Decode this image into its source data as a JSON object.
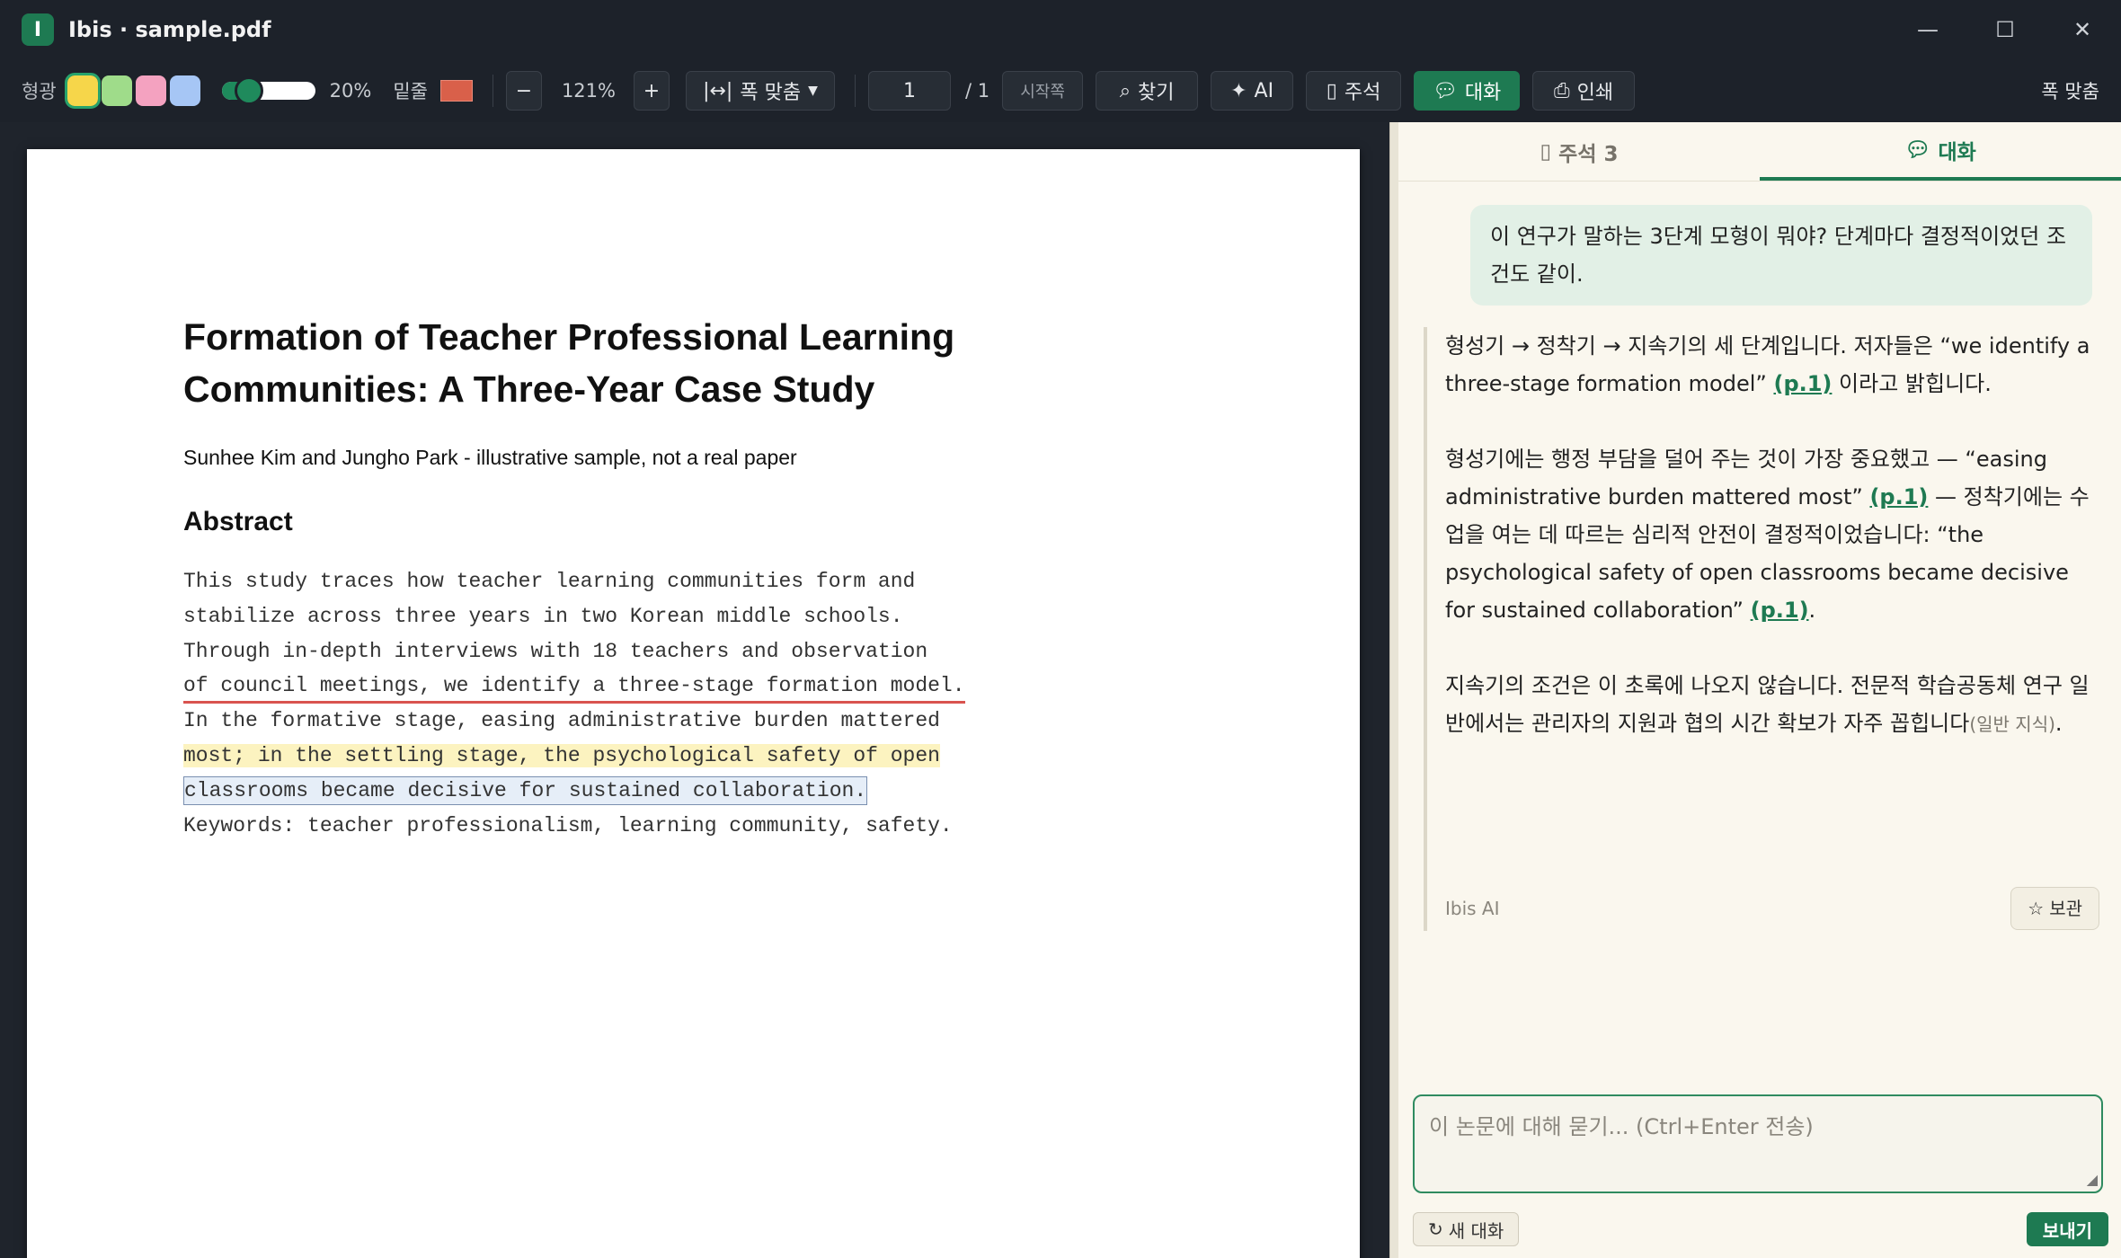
{
  "window": {
    "app_letter": "I",
    "title": "Ibis · sample.pdf",
    "controls": [
      "—",
      "☐",
      "✕"
    ]
  },
  "toolbar": {
    "highlight_label": "형광",
    "swatch_colors": [
      "#f6d64a",
      "#9fdc8a",
      "#f4a2c0",
      "#a6c6f5"
    ],
    "opacity_value": "20%",
    "underline_label": "밑줄",
    "underline_color": "#d9604a",
    "zoom_out": "−",
    "zoom_level": "121%",
    "zoom_in": "+",
    "fit_width": "폭 맞춤",
    "page_current": "1",
    "page_total": "/ 1",
    "first_page": "시작쪽",
    "find": "찾기",
    "ai": "AI",
    "annotations": "주석",
    "chat": "대화",
    "print": "인쇄",
    "fit_width_right": "폭 맞춤"
  },
  "document": {
    "title": "Formation of Teacher Professional Learning Communities: A Three-Year Case Study",
    "authors": "Sunhee Kim and Jungho Park - illustrative sample, not a real paper",
    "abstract_heading": "Abstract",
    "lines": [
      "This study traces how teacher learning communities form and",
      "stabilize across three years in two Korean middle schools.",
      "Through in-depth interviews with 18 teachers and observation",
      "of council meetings, we identify a three-stage formation model.",
      "In the formative stage, easing administrative burden mattered",
      "most; in the settling stage, the psychological safety of open",
      "classrooms became decisive for sustained collaboration.",
      "Keywords: teacher professionalism, learning community, safety."
    ]
  },
  "panel": {
    "tab_annotations": "주석 3",
    "tab_chat": "대화",
    "user_message": "이 연구가 말하는 3단계 모형이 뭐야? 단계마다 결정적이었던 조건도 같이.",
    "ai_p1_a": "형성기 → 정착기 → 지속기의 세 단계입니다. 저자들은 “we identify a three-stage formation model” ",
    "ai_p1_cite": "(p.1)",
    "ai_p1_b": " 이라고 밝힙니다.",
    "ai_p2_a": "형성기에는 행정 부담을 덜어 주는 것이 가장 중요했고 — “easing administrative burden mattered most” ",
    "ai_p2_cite1": "(p.1)",
    "ai_p2_b": " — 정착기에는 수업을 여는 데 따르는 심리적 안전이 결정적이었습니다: “the psychological safety of open classrooms became decisive for sustained collaboration” ",
    "ai_p2_cite2": "(p.1)",
    "ai_p2_c": ".",
    "ai_p3_a": "지속기의 조건은 이 초록에 나오지 않습니다. 전문적 학습공동체 연구 일반에서는 관리자의 지원과 협의 시간 확보가 자주 꼽힙니다",
    "ai_p3_note": "(일반 지식)",
    "ai_p3_b": ".",
    "ai_sender": "Ibis AI",
    "save_label": "보관",
    "composer_placeholder": "이 논문에 대해 묻기...  (Ctrl+Enter 전송)",
    "new_chat": "새 대화",
    "send": "보내기"
  }
}
